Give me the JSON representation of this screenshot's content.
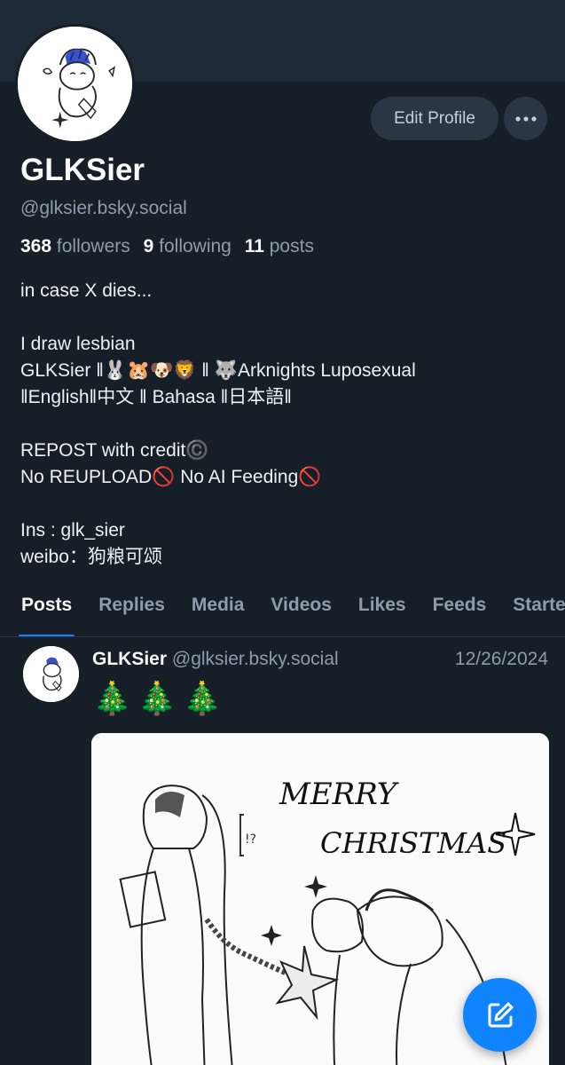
{
  "profile": {
    "display_name": "GLKSier",
    "handle": "@glksier.bsky.social",
    "edit_label": "Edit Profile",
    "stats": {
      "followers_count": "368",
      "followers_label": "followers",
      "following_count": "9",
      "following_label": "following",
      "posts_count": "11",
      "posts_label": "posts"
    },
    "bio": "in case X dies...\n\nI draw lesbian\nGLKSier ‖🐰🐹🐶🦁 ‖ 🐺Arknights Luposexual\n‖English‖中文 ‖ Bahasa ‖日本語‖\n\nREPOST with credit©️\nNo REUPLOAD🚫 No AI Feeding🚫\n\nIns : glk_sier\nweibo：狗粮可颂"
  },
  "tabs": [
    {
      "label": "Posts",
      "active": true
    },
    {
      "label": "Replies",
      "active": false
    },
    {
      "label": "Media",
      "active": false
    },
    {
      "label": "Videos",
      "active": false
    },
    {
      "label": "Likes",
      "active": false
    },
    {
      "label": "Feeds",
      "active": false
    },
    {
      "label": "Starter Packs",
      "active": false
    }
  ],
  "post": {
    "author": "GLKSier",
    "handle": "@glksier.bsky.social",
    "date": "12/26/2024",
    "text": "🎄🎄🎄",
    "image_text_1": "MERRY",
    "image_text_2": "CHRISTMAS",
    "image_text_3": "!?"
  },
  "icons": {
    "more": "ellipsis-icon",
    "compose": "compose-icon"
  },
  "colors": {
    "background": "#161e27",
    "banner": "#1e2936",
    "accent": "#1083fe",
    "muted_text": "#8f9cab"
  }
}
